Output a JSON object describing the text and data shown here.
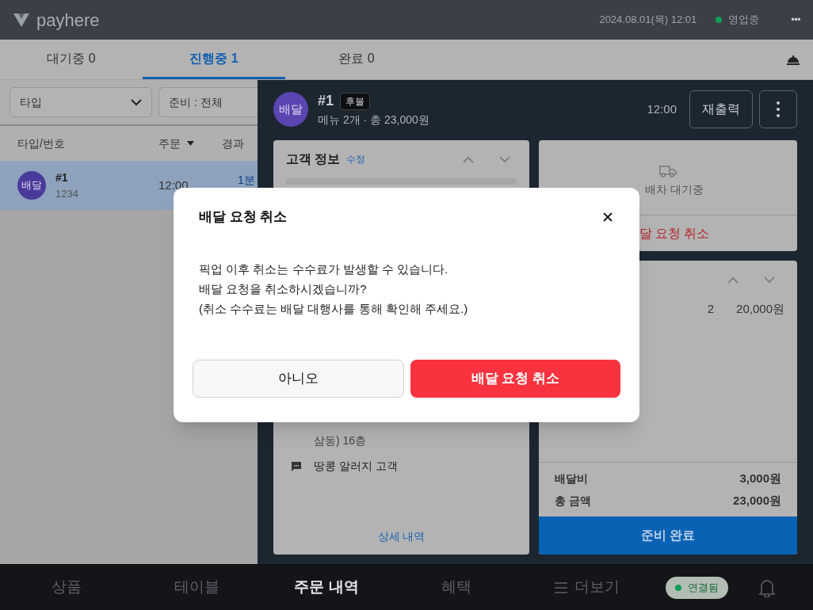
{
  "header": {
    "brand": "payhere",
    "datetime": "2024.08.01(목) 12:01",
    "status": "영업중",
    "more": "•••"
  },
  "tabs": [
    {
      "label": "대기중 0",
      "selected": false
    },
    {
      "label": "진행중 1",
      "selected": true
    },
    {
      "label": "완료 0",
      "selected": false
    }
  ],
  "filters": [
    {
      "label": "타입",
      "kind": "dropdown"
    },
    {
      "label": "준비 : 전체",
      "kind": "plain"
    }
  ],
  "list": {
    "columns": [
      "타입/번호",
      "주문",
      "경과"
    ],
    "rows": [
      {
        "badge": "배달",
        "number": "#1",
        "code": "1234",
        "time": "12:00",
        "elapsed": "1분",
        "selected": true
      }
    ]
  },
  "order": {
    "badge": "배달",
    "number": "#1",
    "payment_tag": "후불",
    "summary": "메뉴 2개 · 총 23,000원",
    "time": "12:00",
    "reprint": "재출력"
  },
  "customer_card": {
    "title": "고객 정보",
    "edit": "수정",
    "address_tail": "삼동) 16층",
    "memo": "땅콩 알러지 고객",
    "details": "상세 내역"
  },
  "delivery_card": {
    "status": "배차 대기중",
    "cancel": "달 요청 취소"
  },
  "menu_card": {
    "item_qty": "2",
    "item_price": "20,000원",
    "fees": [
      {
        "label": "배달비",
        "value": "3,000원"
      },
      {
        "label": "총 금액",
        "value": "23,000원"
      }
    ],
    "done": "준비 완료"
  },
  "dialog": {
    "title": "배달 요청 취소",
    "lines": [
      "픽업 이후 취소는 수수료가 발생할 수 있습니다.",
      "배달 요청을 취소하시겠습니까?",
      "(취소 수수료는 배달 대행사를 통해 확인해 주세요.)"
    ],
    "buttons": [
      {
        "label": "아니오",
        "kind": "secondary"
      },
      {
        "label": "배달 요청 취소",
        "kind": "danger"
      }
    ]
  },
  "bottom_nav": {
    "items": [
      {
        "label": "상품",
        "selected": false
      },
      {
        "label": "테이블",
        "selected": false
      },
      {
        "label": "주문 내역",
        "selected": true
      },
      {
        "label": "혜택",
        "selected": false
      },
      {
        "label": "더보기",
        "selected": false
      }
    ],
    "connection": "연결됨"
  }
}
